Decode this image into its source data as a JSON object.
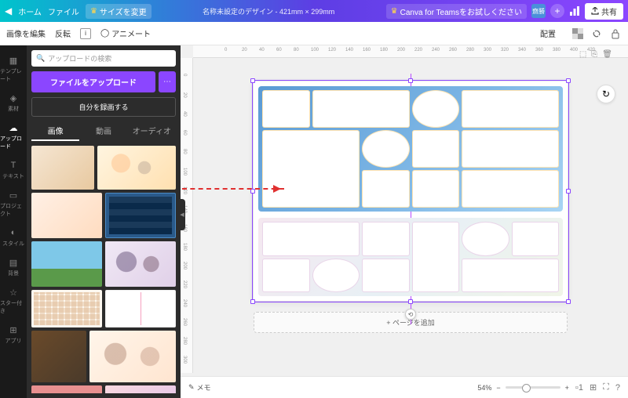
{
  "topbar": {
    "home": "ホーム",
    "file": "ファイル",
    "resize": "サイズを変更",
    "doc_title": "名称未設定のデザイン - 421mm × 299mm",
    "try_teams": "Canva for Teamsをお試しください",
    "avatar": "齋勝",
    "share": "共有"
  },
  "toolbar": {
    "edit_image": "画像を編集",
    "flip": "反転",
    "animate": "アニメート",
    "position": "配置"
  },
  "rail": {
    "items": [
      "テンプレート",
      "素材",
      "アップロード",
      "テキスト",
      "プロジェクト",
      "スタイル",
      "背景",
      "スター付き",
      "アプリ"
    ]
  },
  "panel": {
    "search_ph": "アップロードの検索",
    "upload": "ファイルをアップロード",
    "record": "自分を録画する",
    "tabs": [
      "画像",
      "動画",
      "オーディオ"
    ]
  },
  "canvas": {
    "ruler_marks": [
      "0",
      "20",
      "40",
      "60",
      "80",
      "100",
      "120",
      "140",
      "160",
      "180",
      "200",
      "220",
      "240",
      "260",
      "280",
      "300",
      "320",
      "340",
      "360",
      "380",
      "400",
      "420"
    ],
    "ruler_v": [
      "0",
      "20",
      "40",
      "60",
      "80",
      "100",
      "120",
      "140",
      "160",
      "180",
      "200",
      "220",
      "240",
      "260",
      "280",
      "300"
    ],
    "add_page": "+ ページを追加"
  },
  "bottom": {
    "memo": "メモ",
    "zoom": "54%",
    "page": "1"
  }
}
